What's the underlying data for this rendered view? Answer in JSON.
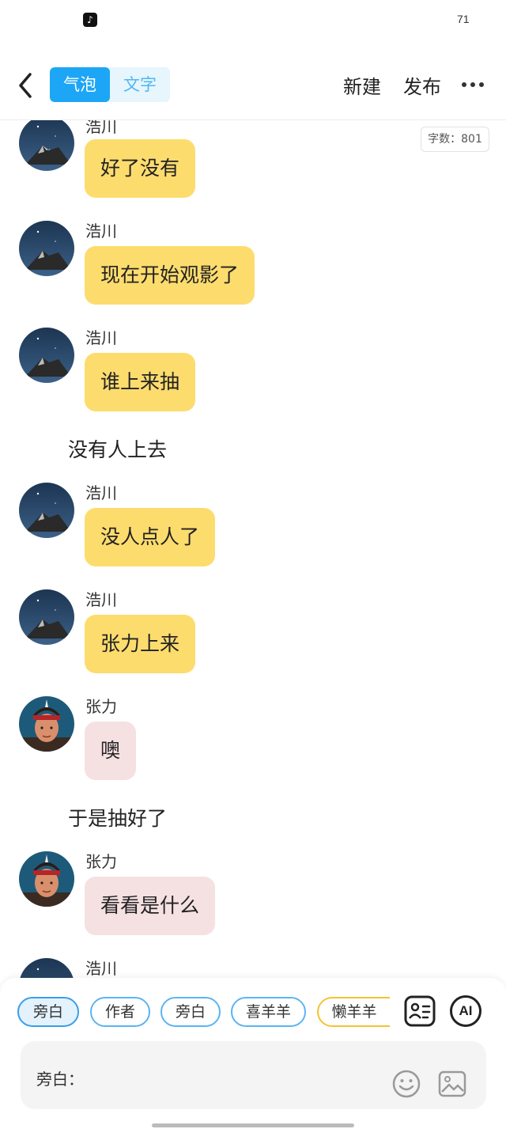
{
  "status_bar": {
    "app_icon": "tiktok-icon",
    "battery": "71"
  },
  "header": {
    "back_icon": "chevron-left-icon",
    "mode_tabs": [
      "气泡",
      "文字"
    ],
    "new_label": "新建",
    "publish_label": "发布",
    "more_icon": "more-horizontal-icon"
  },
  "word_count": "字数：801",
  "messages": [
    {
      "type": "bubble",
      "speaker": "浩川",
      "text": "好了没有",
      "style": "yellow"
    },
    {
      "type": "bubble",
      "speaker": "浩川",
      "text": "现在开始观影了",
      "style": "yellow"
    },
    {
      "type": "bubble",
      "speaker": "浩川",
      "text": "谁上来抽",
      "style": "yellow"
    },
    {
      "type": "narration",
      "text": "没有人上去"
    },
    {
      "type": "bubble",
      "speaker": "浩川",
      "text": "没人点人了",
      "style": "yellow"
    },
    {
      "type": "bubble",
      "speaker": "浩川",
      "text": "张力上来",
      "style": "yellow"
    },
    {
      "type": "bubble",
      "speaker": "张力",
      "text": "噢",
      "style": "pink"
    },
    {
      "type": "narration",
      "text": "于是抽好了"
    },
    {
      "type": "bubble",
      "speaker": "张力",
      "text": "看看是什么",
      "style": "pink"
    },
    {
      "type": "bubble",
      "speaker": "浩川",
      "text": "",
      "style": "yellow"
    }
  ],
  "role_chips": [
    "旁白",
    "作者",
    "旁白",
    "喜羊羊",
    "懒羊羊"
  ],
  "toolbar_icons": [
    "contact-card-icon",
    "ai-icon"
  ],
  "ai_label": "AI",
  "input": {
    "label": "旁白："
  },
  "input_icons": [
    "emoji-icon",
    "image-icon"
  ],
  "colors": {
    "accent": "#1da6f5",
    "bubble_yellow": "#fddc6e",
    "bubble_pink": "#f5e0e2"
  }
}
